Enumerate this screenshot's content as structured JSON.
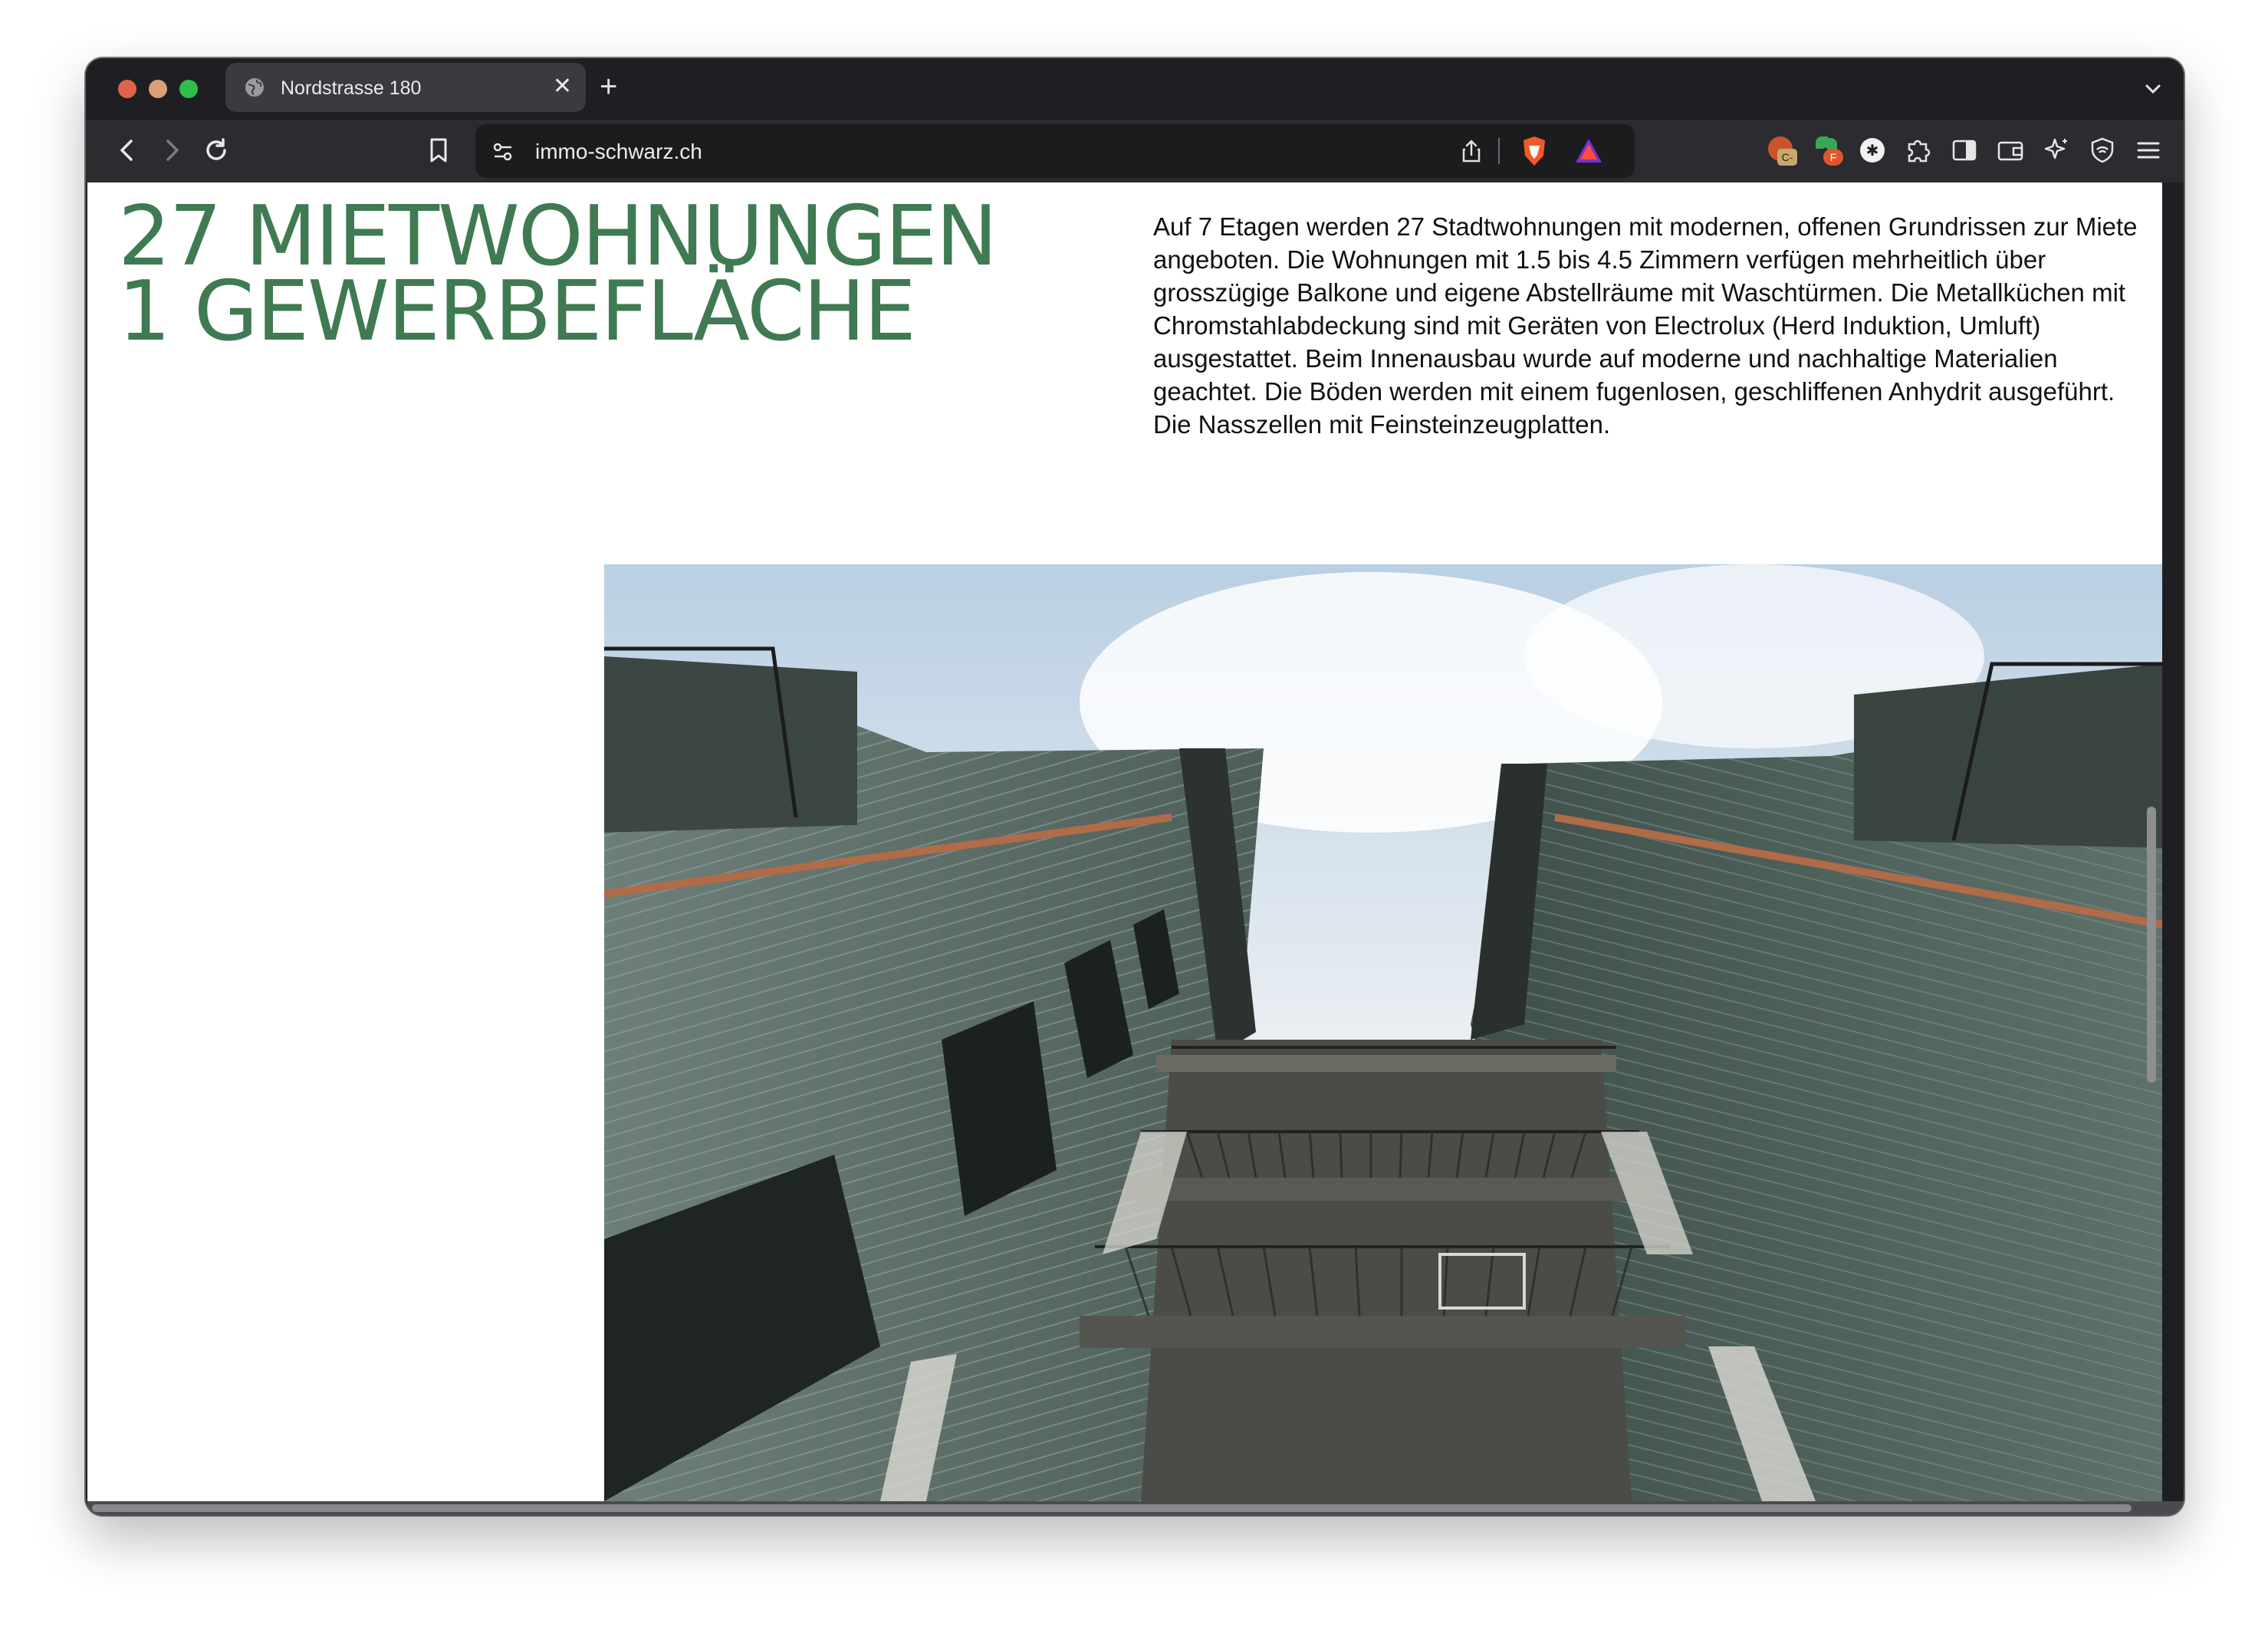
{
  "browser": {
    "tab": {
      "title": "Nordstrasse 180",
      "close_glyph": "✕"
    },
    "new_tab_glyph": "+",
    "url": "immo-schwarz.ch",
    "icons": [
      "back-icon",
      "forward-icon",
      "reload-icon",
      "bookmark-icon",
      "site-settings-icon",
      "share-icon",
      "brave-shield-icon",
      "brave-rewards-icon",
      "extension-icons",
      "puzzle-icon",
      "sidebar-icon",
      "wallet-icon",
      "leo-ai-icon",
      "vpn-icon",
      "menu-icon"
    ],
    "extension_badges": {
      "first": "C-",
      "second": "F"
    }
  },
  "page": {
    "headline": {
      "line1": "27 MIETWOHNUNGEN",
      "line2": "1 GEWERBEFLÄCHE"
    },
    "description": "Auf 7 Etagen werden 27 Stadtwohnungen mit modernen, offenen Grundrissen zur Miete angeboten. Die Wohnungen mit 1.5 bis 4.5 Zimmern verfügen mehrheitlich über grosszügige Balkone und eigene Abstellräume mit Waschtürmen. Die Metallküchen mit Chromstahlabdeckung sind mit Geräten von Electrolux (Herd Induktion, Umluft) ausgestattet. Beim Innenausbau wurde auf moderne und nachhaltige Materialien geachtet. Die Böden werden mit einem fugenlosen, geschliffenen Anhydrit ausgeführt. Die Nasszellen mit Feinsteinzeugplatten.",
    "accent_color": "#3f7a52"
  }
}
